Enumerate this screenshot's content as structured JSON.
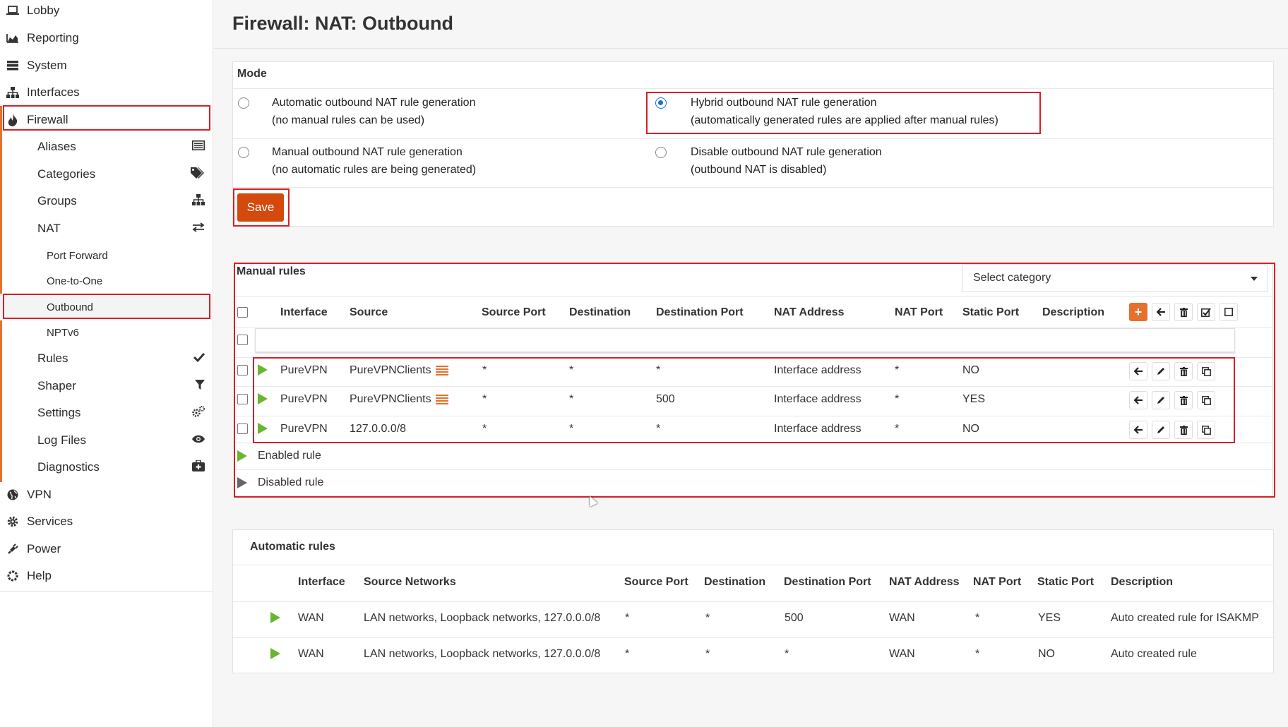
{
  "sidebar": {
    "items": [
      {
        "label": "Lobby",
        "icon": "laptop-icon"
      },
      {
        "label": "Reporting",
        "icon": "area-chart-icon"
      },
      {
        "label": "System",
        "icon": "server-icon"
      },
      {
        "label": "Interfaces",
        "icon": "sitemap-icon"
      },
      {
        "label": "Firewall",
        "icon": "fire-icon"
      },
      {
        "label": "Aliases",
        "icon": "list-alt-icon"
      },
      {
        "label": "Categories",
        "icon": "tags-icon"
      },
      {
        "label": "Groups",
        "icon": "sitemap-icon"
      },
      {
        "label": "NAT",
        "icon": "exchange-icon"
      },
      {
        "label": "Port Forward"
      },
      {
        "label": "One-to-One"
      },
      {
        "label": "Outbound"
      },
      {
        "label": "NPTv6"
      },
      {
        "label": "Rules",
        "icon": "check-icon"
      },
      {
        "label": "Shaper",
        "icon": "filter-icon"
      },
      {
        "label": "Settings",
        "icon": "cogs-icon"
      },
      {
        "label": "Log Files",
        "icon": "eye-icon"
      },
      {
        "label": "Diagnostics",
        "icon": "medkit-icon"
      },
      {
        "label": "VPN",
        "icon": "globe-icon"
      },
      {
        "label": "Services",
        "icon": "cog-icon"
      },
      {
        "label": "Power",
        "icon": "plug-icon"
      },
      {
        "label": "Help",
        "icon": "life-ring-icon"
      }
    ]
  },
  "page": {
    "title": "Firewall: NAT: Outbound"
  },
  "mode": {
    "header": "Mode",
    "options": [
      {
        "line1": "Automatic outbound NAT rule generation",
        "line2": "(no manual rules can be used)",
        "selected": false
      },
      {
        "line1": "Hybrid outbound NAT rule generation",
        "line2": "(automatically generated rules are applied after manual rules)",
        "selected": true
      },
      {
        "line1": "Manual outbound NAT rule generation",
        "line2": "(no automatic rules are being generated)",
        "selected": false
      },
      {
        "line1": "Disable outbound NAT rule generation",
        "line2": "(outbound NAT is disabled)",
        "selected": false
      }
    ],
    "save_label": "Save"
  },
  "manual": {
    "header": "Manual rules",
    "category_placeholder": "Select category",
    "columns": [
      "Interface",
      "Source",
      "Source Port",
      "Destination",
      "Destination Port",
      "NAT Address",
      "NAT Port",
      "Static Port",
      "Description"
    ],
    "rows": [
      {
        "interface": "PureVPN",
        "source": "PureVPNClients",
        "source_port": "*",
        "destination": "*",
        "destination_port": "*",
        "nat_address": "Interface address",
        "nat_port": "*",
        "static_port": "NO",
        "description": ""
      },
      {
        "interface": "PureVPN",
        "source": "PureVPNClients",
        "source_port": "*",
        "destination": "*",
        "destination_port": "500",
        "nat_address": "Interface address",
        "nat_port": "*",
        "static_port": "YES",
        "description": ""
      },
      {
        "interface": "PureVPN",
        "source": "127.0.0.0/8",
        "source_port": "*",
        "destination": "*",
        "destination_port": "*",
        "nat_address": "Interface address",
        "nat_port": "*",
        "static_port": "NO",
        "description": ""
      }
    ],
    "legend": {
      "enabled": "Enabled rule",
      "disabled": "Disabled rule"
    }
  },
  "automatic": {
    "header": "Automatic rules",
    "columns": [
      "Interface",
      "Source Networks",
      "Source Port",
      "Destination",
      "Destination Port",
      "NAT Address",
      "NAT Port",
      "Static Port",
      "Description"
    ],
    "rows": [
      {
        "interface": "WAN",
        "source": "LAN networks, Loopback networks, 127.0.0.0/8",
        "source_port": "*",
        "destination": "*",
        "destination_port": "500",
        "nat_address": "WAN",
        "nat_port": "*",
        "static_port": "YES",
        "description": "Auto created rule for ISAKMP"
      },
      {
        "interface": "WAN",
        "source": "LAN networks, Loopback networks, 127.0.0.0/8",
        "source_port": "*",
        "destination": "*",
        "destination_port": "*",
        "nat_address": "WAN",
        "nat_port": "*",
        "static_port": "NO",
        "description": "Auto created rule"
      }
    ]
  },
  "colors": {
    "accent": "#e6702e",
    "save": "#d4490e",
    "enabled": "#6ab52e",
    "highlight": "#d3202a",
    "radio": "#1d6fd6"
  }
}
